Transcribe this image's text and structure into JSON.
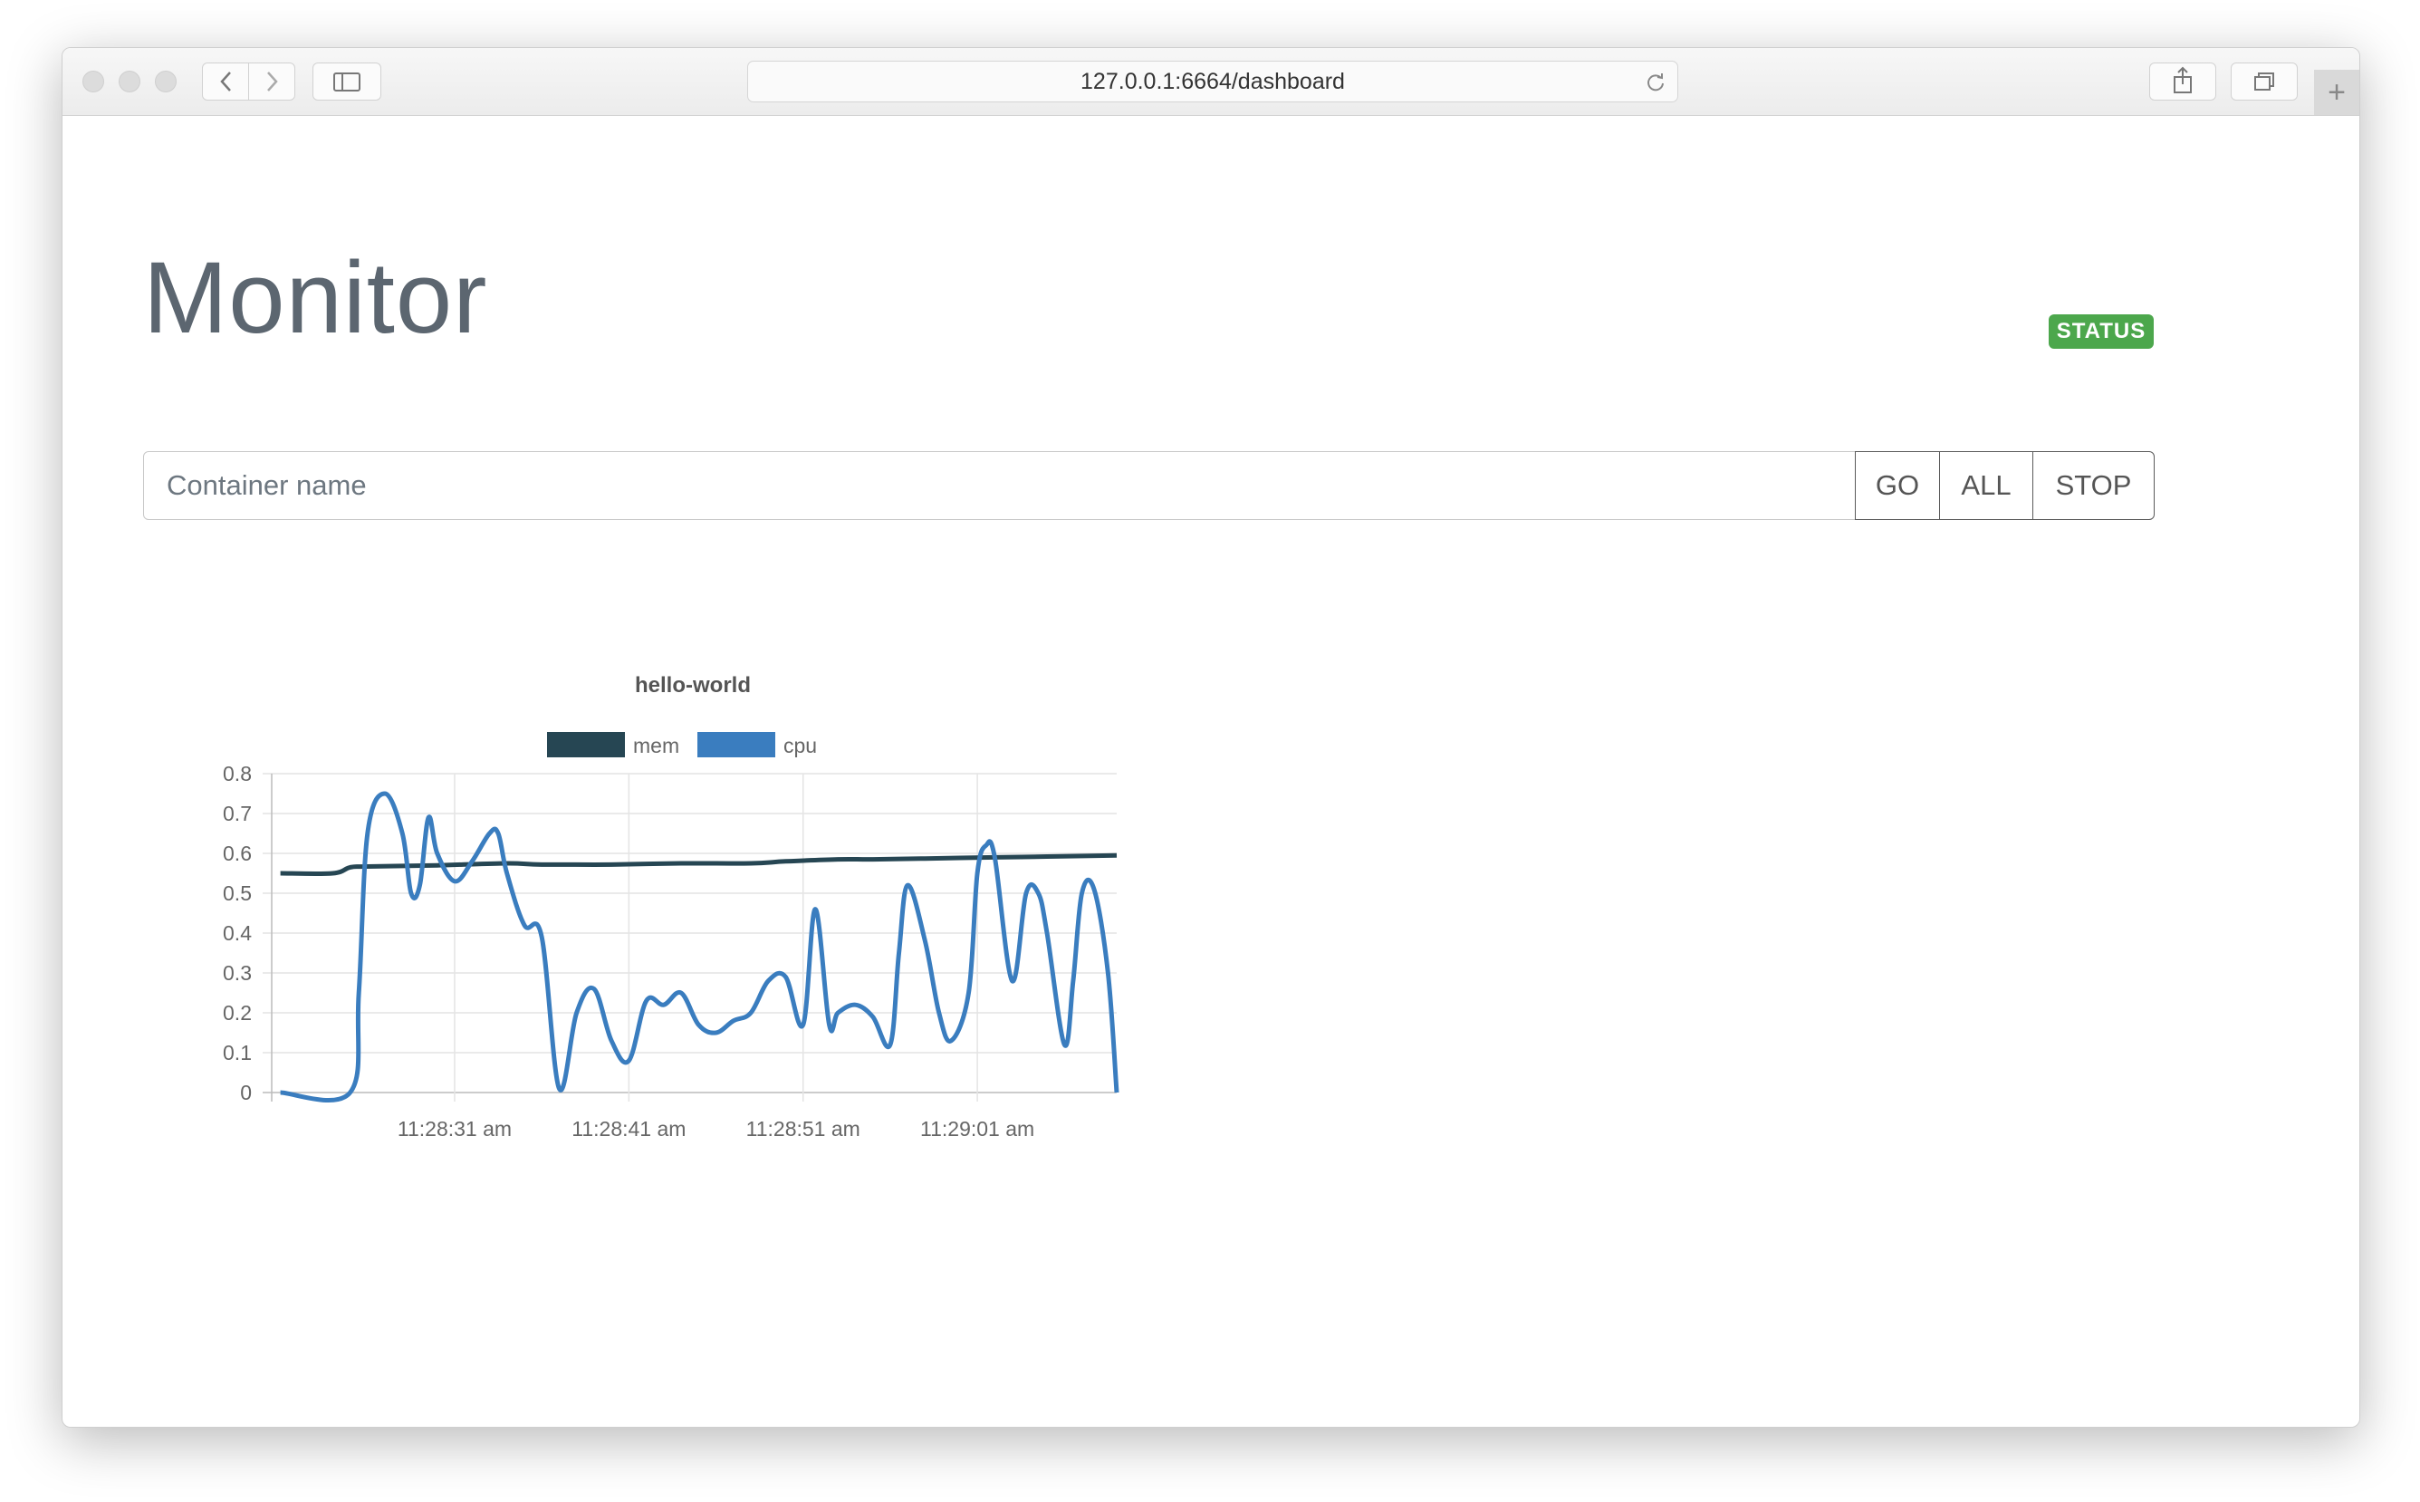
{
  "browser": {
    "url": "127.0.0.1:6664/dashboard",
    "new_tab_symbol": "+"
  },
  "page": {
    "title": "Monitor",
    "status_label": "STATUS",
    "status_color": "#4ca74c"
  },
  "search": {
    "placeholder": "Container name",
    "value": "",
    "go_label": "GO",
    "all_label": "ALL",
    "stop_label": "STOP"
  },
  "chart_data": {
    "type": "line",
    "title": "hello-world",
    "xlabel": "",
    "ylabel": "",
    "ylim": [
      0,
      0.8
    ],
    "y_ticks": [
      "0",
      "0.1",
      "0.2",
      "0.3",
      "0.4",
      "0.5",
      "0.6",
      "0.7",
      "0.8"
    ],
    "x_ticks": [
      "11:28:31 am",
      "11:28:41 am",
      "11:28:51 am",
      "11:29:01 am"
    ],
    "x_tick_seconds": [
      31,
      41,
      51,
      61
    ],
    "xlim": [
      20.5,
      69
    ],
    "grid": true,
    "legend_position": "top-center",
    "series": [
      {
        "name": "mem",
        "color": "#264653",
        "x": [
          21,
          24,
          25,
          26,
          30,
          34,
          36,
          40,
          44,
          48,
          50,
          53,
          55,
          58,
          62,
          65,
          69
        ],
        "values": [
          0.55,
          0.55,
          0.565,
          0.567,
          0.57,
          0.575,
          0.572,
          0.572,
          0.575,
          0.575,
          0.58,
          0.585,
          0.585,
          0.587,
          0.59,
          0.592,
          0.595
        ]
      },
      {
        "name": "cpu",
        "color": "#3a7dbf",
        "x": [
          21,
          25,
          25.5,
          26,
          27,
          28,
          28.5,
          29,
          29.5,
          30,
          31,
          32,
          33,
          33.5,
          34,
          35,
          36,
          37,
          38,
          39,
          40,
          41,
          42,
          43,
          44,
          45,
          46,
          47,
          48,
          49,
          50,
          51,
          51.7,
          52.5,
          53,
          54,
          55,
          56,
          56.5,
          57,
          58,
          58.8,
          59.5,
          60.5,
          61,
          61.5,
          62,
          63,
          63.8,
          64.5,
          65,
          66,
          66.5,
          67,
          67.7,
          68.5,
          69
        ],
        "values": [
          0,
          0,
          0.25,
          0.65,
          0.75,
          0.65,
          0.5,
          0.52,
          0.69,
          0.6,
          0.53,
          0.58,
          0.65,
          0.65,
          0.55,
          0.42,
          0.39,
          0.01,
          0.2,
          0.26,
          0.13,
          0.08,
          0.23,
          0.22,
          0.25,
          0.17,
          0.15,
          0.18,
          0.2,
          0.28,
          0.29,
          0.17,
          0.46,
          0.17,
          0.2,
          0.22,
          0.19,
          0.12,
          0.35,
          0.52,
          0.38,
          0.2,
          0.13,
          0.25,
          0.55,
          0.62,
          0.59,
          0.28,
          0.5,
          0.5,
          0.4,
          0.12,
          0.28,
          0.5,
          0.51,
          0.3,
          0
        ]
      }
    ]
  }
}
